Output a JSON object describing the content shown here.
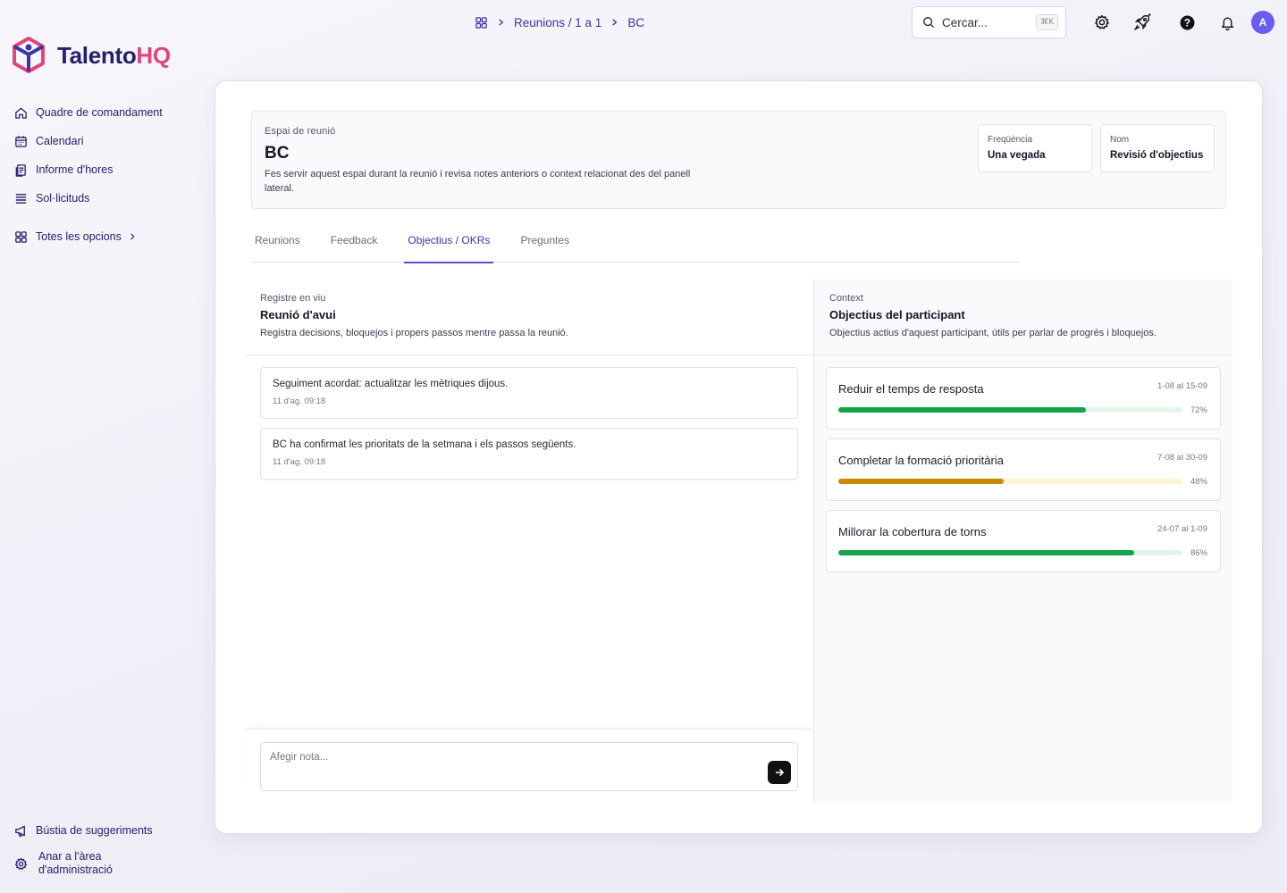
{
  "brand": {
    "name_main": "Talento",
    "name_accent": "HQ"
  },
  "sidebar": {
    "items": [
      {
        "label": "Quadre de comandament",
        "icon": "home-icon"
      },
      {
        "label": "Calendari",
        "icon": "calendar-icon"
      },
      {
        "label": "Informe d'hores",
        "icon": "report-icon"
      },
      {
        "label": "Sol·licituds",
        "icon": "list-icon"
      }
    ],
    "all_options": "Totes les opcions",
    "bottom": {
      "feedback": "Bústia de suggeriments",
      "admin_line1": "Anar a l'àrea",
      "admin_line2": "d'administració"
    }
  },
  "topbar": {
    "breadcrumb": {
      "section": "Reunions / 1 a 1",
      "current": "BC"
    },
    "search": {
      "placeholder": "Cercar...",
      "shortcut": "⌘K"
    },
    "avatar_initial": "A"
  },
  "space": {
    "eyebrow": "Espai de reunió",
    "title": "BC",
    "description": "Fes servir aquest espai durant la reunió i revisa notes anteriors o context relacionat des del panell lateral.",
    "frequency_label": "Freqüència",
    "frequency_value": "Una vegada",
    "name_label": "Nom",
    "name_value": "Revisió d'objectius"
  },
  "tabs": [
    {
      "label": "Reunions",
      "active": false
    },
    {
      "label": "Feedback",
      "active": false
    },
    {
      "label": "Objectius / OKRs",
      "active": true
    },
    {
      "label": "Preguntes",
      "active": false
    }
  ],
  "live_log": {
    "eyebrow": "Registre en viu",
    "title": "Reunió d'avui",
    "subtitle": "Registra decisions, bloquejos i propers passos mentre passa la reunió.",
    "notes": [
      {
        "text": "Seguiment acordat: actualitzar les mètriques dijous.",
        "time": "11 d'ag. 09:18"
      },
      {
        "text": "BC ha confirmat les prioritats de la setmana i els passos següents.",
        "time": "11 d'ag. 09:18"
      }
    ],
    "composer_placeholder": "Afegir nota..."
  },
  "context": {
    "eyebrow": "Context",
    "title": "Objectius del participant",
    "subtitle": "Objectius actius d'aquest participant, útils per parlar de progrés i bloquejos.",
    "goals": [
      {
        "title": "Reduir el temps de resposta",
        "range": "1-08 al 15-09",
        "progress": 72,
        "pct_label": "72%",
        "color": "#16a34a",
        "track": "#e4f6e9"
      },
      {
        "title": "Completar la formació prioritària",
        "range": "7-08 al 30-09",
        "progress": 48,
        "pct_label": "48%",
        "color": "#ca8a04",
        "track": "#fbf5d4"
      },
      {
        "title": "Millorar la cobertura de torns",
        "range": "24-07 al 1-09",
        "progress": 86,
        "pct_label": "86%",
        "color": "#16a34a",
        "track": "#e4f6e9"
      }
    ]
  }
}
